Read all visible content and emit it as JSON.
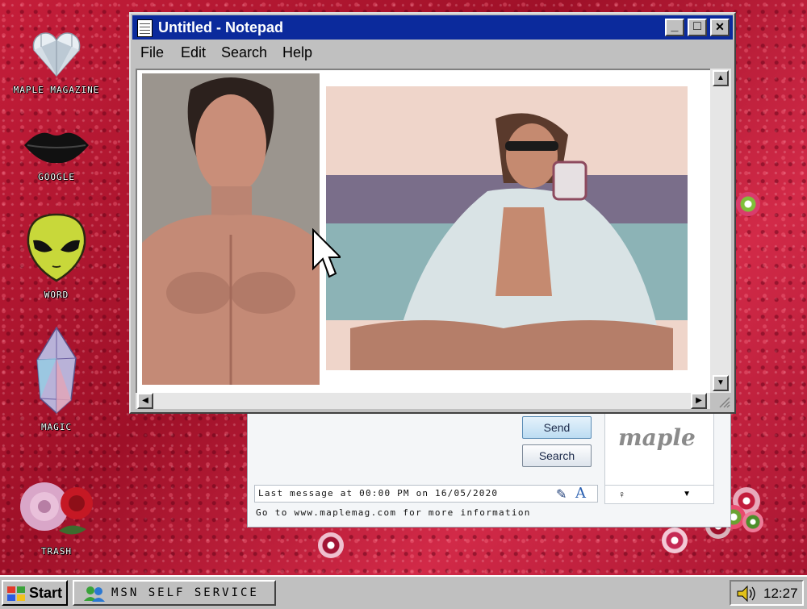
{
  "desktop": {
    "icons": [
      {
        "label": "MAPLE MAGAZINE",
        "icon": "diamond-heart-icon"
      },
      {
        "label": "GOOGLE",
        "icon": "lips-icon"
      },
      {
        "label": "WORD",
        "icon": "alien-icon"
      },
      {
        "label": "MAGIC",
        "icon": "crystal-icon"
      },
      {
        "label": "TRASH",
        "icon": "roses-icon"
      }
    ]
  },
  "notepad": {
    "title": "Untitled - Notepad",
    "menu": {
      "file": "File",
      "edit": "Edit",
      "search": "Search",
      "help": "Help"
    },
    "controls": {
      "minimize": "_",
      "maximize": "□",
      "close": "✕"
    }
  },
  "chat": {
    "send_label": "Send",
    "search_label": "Search",
    "status_text": "Last message at 00:00 PM on 16/05/2020",
    "info_text": "Go to www.maplemag.com for more information",
    "avatar_text": "maple"
  },
  "taskbar": {
    "start_label": "Start",
    "task_label": "MSN SELF SERVICE",
    "clock": "12:27"
  },
  "colors": {
    "titlebar": "#0b2a9c",
    "desktop_glitter": "#c51e3a",
    "window_chrome": "#c0c0c0"
  }
}
